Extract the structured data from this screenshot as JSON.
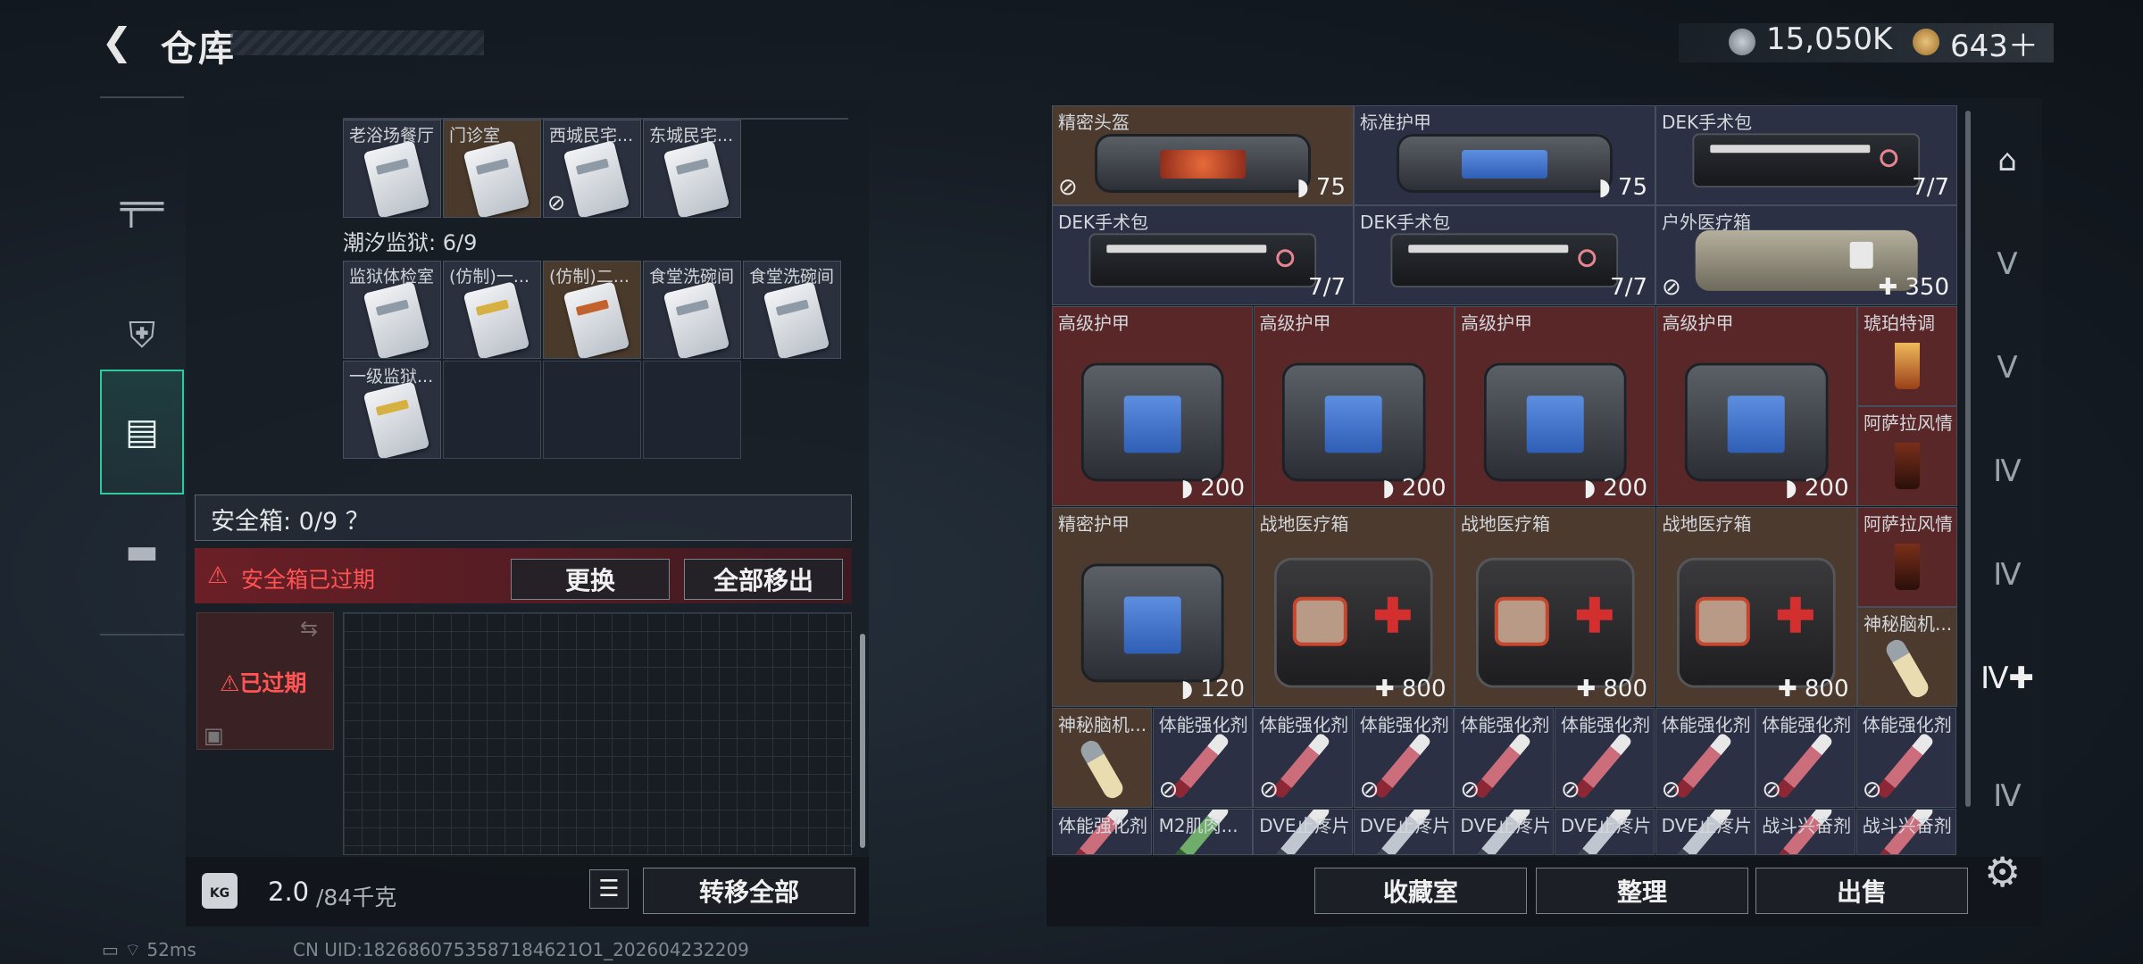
{
  "header": {
    "title": "仓库",
    "money": "15,050K",
    "tokens": "643＋"
  },
  "nav": {
    "items": [
      "枪械",
      "装备",
      "仓库",
      "工具箱"
    ]
  },
  "left": {
    "row1": [
      {
        "label": "老浴场餐厅",
        "bg": "blue",
        "nofx": false
      },
      {
        "label": "门诊室",
        "bg": "orange",
        "nofx": false
      },
      {
        "label": "西城民宅...",
        "bg": "blue",
        "nofx": true
      },
      {
        "label": "东城民宅...",
        "bg": "blue",
        "nofx": false
      }
    ],
    "prison_title": "潮汐监狱: 6/9",
    "row2": [
      {
        "label": "监狱体检室",
        "bg": "blue",
        "card": "normal"
      },
      {
        "label": "(仿制)一...",
        "bg": "blue",
        "card": "gold"
      },
      {
        "label": "(仿制)二...",
        "bg": "orange",
        "card": "red"
      },
      {
        "label": "食堂洗碗间",
        "bg": "blue",
        "card": "normal"
      },
      {
        "label": "食堂洗碗间",
        "bg": "blue",
        "card": "normal"
      }
    ],
    "row3": [
      {
        "label": "一级监狱...",
        "bg": "blue",
        "card": "gold"
      }
    ],
    "safebox_label": "安全箱: 0/9 ？",
    "warn_text": "安全箱已过期",
    "btn_replace": "更换",
    "btn_move_all": "全部移出",
    "expired_label": "⚠已过期",
    "weight": "2.0",
    "weight_unit": "/84千克",
    "btn_transfer_all": "转移全部"
  },
  "right": {
    "row1": [
      {
        "label": "精密头盔",
        "val": "◗ 75",
        "nofx": true,
        "type": "helmet"
      },
      {
        "label": "标准护甲",
        "val": "◗ 75",
        "nofx": false,
        "type": "armor"
      },
      {
        "label": "DEK手术包",
        "val": "7/7",
        "nofx": false,
        "type": "kit"
      }
    ],
    "row2": [
      {
        "label": "DEK手术包",
        "val": "7/7",
        "type": "kit"
      },
      {
        "label": "DEK手术包",
        "val": "7/7",
        "type": "kit"
      },
      {
        "label": "户外医疗箱",
        "val": "✚ 350",
        "type": "outdoor",
        "nofx": true
      }
    ],
    "row3": [
      {
        "label": "高级护甲",
        "val": "◗ 200"
      },
      {
        "label": "高级护甲",
        "val": "◗ 200"
      },
      {
        "label": "高级护甲",
        "val": "◗ 200"
      },
      {
        "label": "高级护甲",
        "val": "◗ 200"
      }
    ],
    "row3_side": [
      {
        "label": "琥珀特调"
      },
      {
        "label": "阿萨拉风情"
      }
    ],
    "row4": [
      {
        "label": "精密护甲",
        "val": "◗ 120",
        "type": "armor"
      },
      {
        "label": "战地医疗箱",
        "val": "✚ 800",
        "type": "med"
      },
      {
        "label": "战地医疗箱",
        "val": "✚ 800",
        "type": "med"
      },
      {
        "label": "战地医疗箱",
        "val": "✚ 800",
        "type": "med"
      }
    ],
    "row4_side": [
      {
        "label": "阿萨拉风情"
      },
      {
        "label": "神秘脑机..."
      }
    ],
    "row5": [
      {
        "label": "神秘脑机...",
        "type": "brain",
        "nofx": false
      },
      {
        "label": "体能强化剂",
        "type": "syr",
        "nofx": true
      },
      {
        "label": "体能强化剂",
        "type": "syr",
        "nofx": true
      },
      {
        "label": "体能强化剂",
        "type": "syr",
        "nofx": true
      },
      {
        "label": "体能强化剂",
        "type": "syr",
        "nofx": true
      },
      {
        "label": "体能强化剂",
        "type": "syr",
        "nofx": true
      },
      {
        "label": "体能强化剂",
        "type": "syr",
        "nofx": true
      },
      {
        "label": "体能强化剂",
        "type": "syr",
        "nofx": true
      },
      {
        "label": "体能强化剂",
        "type": "syr",
        "nofx": true
      }
    ],
    "row6": [
      {
        "label": "体能强化剂",
        "type": "syr"
      },
      {
        "label": "M2肌肉...",
        "type": "syrg"
      },
      {
        "label": "DVE止疼片",
        "type": "syrb"
      },
      {
        "label": "DVE止疼片",
        "type": "syrb"
      },
      {
        "label": "DVE止疼片",
        "type": "syrb"
      },
      {
        "label": "DVE止疼片",
        "type": "syrb"
      },
      {
        "label": "DVE止疼片",
        "type": "syrb"
      },
      {
        "label": "战斗兴奋剂",
        "type": "syr"
      },
      {
        "label": "战斗兴奋剂",
        "type": "syr"
      }
    ],
    "btn_collection": "收藏室",
    "btn_sort": "整理",
    "btn_sell": "出售"
  },
  "status": {
    "ping": "52ms",
    "uid": "CN UID:1826860753587184621O1_202604232209"
  }
}
